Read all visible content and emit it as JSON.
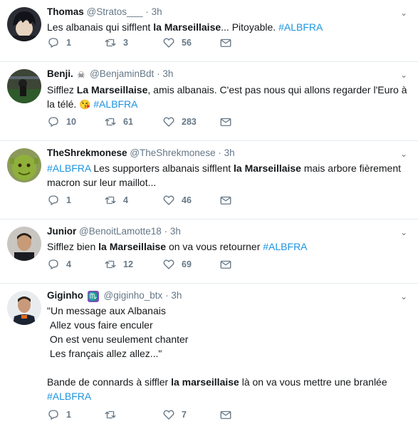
{
  "tweets": [
    {
      "name": "Thomas",
      "handle": "@Stratos___",
      "sep": "·",
      "time": "3h",
      "text_parts": [
        {
          "t": "Les albanais qui sifflent ",
          "s": "plain"
        },
        {
          "t": "la Marseillaise",
          "s": "bold"
        },
        {
          "t": "... Pitoyable. ",
          "s": "plain"
        },
        {
          "t": "#ALBFRA",
          "s": "hash"
        }
      ],
      "replies": "1",
      "retweets": "3",
      "likes": "56"
    },
    {
      "name": "Benji.",
      "handle": "@BenjaminBdt",
      "sep": "·",
      "time": "3h",
      "text_parts": [
        {
          "t": "Sifflez ",
          "s": "plain"
        },
        {
          "t": "La Marseillaise",
          "s": "bold"
        },
        {
          "t": ", amis albanais. C'est pas nous qui allons regarder l'Euro à la télé. ",
          "s": "plain"
        },
        {
          "t": "😘",
          "s": "emoji"
        },
        {
          "t": " ",
          "s": "plain"
        },
        {
          "t": "#ALBFRA",
          "s": "hash"
        }
      ],
      "replies": "10",
      "retweets": "61",
      "likes": "283"
    },
    {
      "name": "TheShrekmonese",
      "handle": "@TheShrekmonese",
      "sep": "·",
      "time": "3h",
      "text_parts": [
        {
          "t": "#ALBFRA",
          "s": "hash"
        },
        {
          "t": " Les supporters albanais sifflent ",
          "s": "plain"
        },
        {
          "t": "la Marseillaise",
          "s": "bold"
        },
        {
          "t": " mais arbore fièrement macron sur leur maillot...",
          "s": "plain"
        }
      ],
      "replies": "1",
      "retweets": "4",
      "likes": "46"
    },
    {
      "name": "Junior",
      "handle": "@BenoitLamotte18",
      "sep": "·",
      "time": "3h",
      "text_parts": [
        {
          "t": "Sifflez bien ",
          "s": "plain"
        },
        {
          "t": "la Marseillaise",
          "s": "bold"
        },
        {
          "t": " on va vous retourner ",
          "s": "plain"
        },
        {
          "t": "#ALBFRA",
          "s": "hash"
        }
      ],
      "replies": "4",
      "retweets": "12",
      "likes": "69"
    },
    {
      "name": "Giginho",
      "badge": "♏",
      "handle": "@giginho_btx",
      "sep": "·",
      "time": "3h",
      "text_parts": [
        {
          "t": "\"Un message aux Albanais\n Allez vous faire enculer\n On est venu seulement chanter\n Les français allez allez...\"\n\nBande de connards à siffler ",
          "s": "plain"
        },
        {
          "t": "la marseillaise",
          "s": "bold"
        },
        {
          "t": " là on va vous mettre une branlée\n",
          "s": "plain"
        },
        {
          "t": "#ALBFRA",
          "s": "hash"
        }
      ],
      "replies": "1",
      "retweets": "",
      "likes": "7"
    }
  ]
}
